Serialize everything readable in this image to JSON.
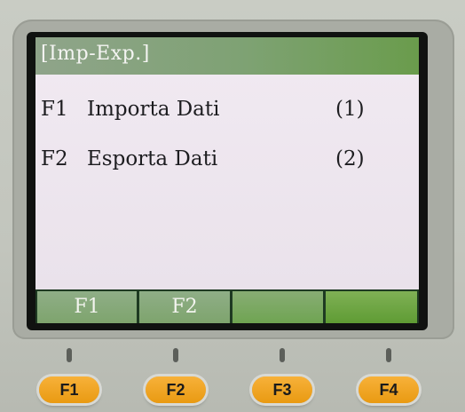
{
  "screen": {
    "title": "[Imp-Exp.]",
    "menu": [
      {
        "key": "F1",
        "label": "Importa Dati",
        "number": "(1)"
      },
      {
        "key": "F2",
        "label": "Esporta Dati",
        "number": "(2)"
      }
    ],
    "softkeys": [
      "F1",
      "F2",
      "",
      ""
    ]
  },
  "hardware_keys": [
    "F1",
    "F2",
    "F3",
    "F4"
  ],
  "colors": {
    "screen_bg": "#ece4ed",
    "titlebar": "#7ea273",
    "key_orange": "#f0a526"
  }
}
